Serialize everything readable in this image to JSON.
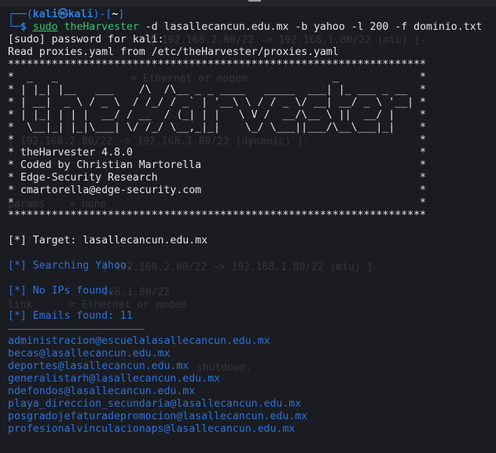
{
  "prompt": {
    "user": "kali",
    "host": "kali",
    "directory": "~",
    "at_symbol": "㉿"
  },
  "command": {
    "sudo": "sudo",
    "program": "theHarvester",
    "args": "-d lasallecancun.edu.mx -b yahoo -l 200 -f dominio.txt"
  },
  "output": {
    "sudo_prompt": "[sudo] password for kali:",
    "proxies_line": "Read proxies.yaml from /etc/theHarvester/proxies.yaml",
    "star_border": "*******************************************************************",
    "banner_lines": [
      "*  _   _                                            _             *",
      "* | |_| |__   ___    /\\  /\\__ _ _ ____   _____  ___| |_ ___ _ __  *",
      "* | __|  _ \\ / _ \\  / /_/ / _` | '__\\ \\ / / _ \\/ __| __/ _ \\ '__| *",
      "* | |_| | | |  __/ / __  / (_| | |   \\ V /  __/\\__ \\ ||  __/ |    *",
      "*  \\__|_| |_|\\___| \\/ /_/ \\__,_|_|    \\_/ \\___||___/\\__\\___|_|    *",
      "*                                                                 *"
    ],
    "info_lines": [
      "* theHarvester 4.8.0                                              *",
      "* Coded by Christian Martorella                                   *",
      "* Edge-Security Research                                          *",
      "* cmartorella@edge-security.com                                   *",
      "*                                                                 *"
    ],
    "target": "[*] Target: lasallecancun.edu.mx",
    "searching": "[*] Searching Yahoo.",
    "no_ips": "[*] No IPs found.",
    "emails_found": "[*] Emails found: 11",
    "emails": [
      "administracion@escuelalasallecancun.edu.mx",
      "becas@lasallecancun.edu.mx",
      "deportes@lasallecancun.edu.mx",
      "generalistarh@lasallecancun.edu.mx",
      "ndefondos@lasallecancun.edu.mx",
      "playa_direccion_secundaria@lasallecancun.edu.mx",
      "posgradojefaturadepromocion@lasallecancun.edu.mx",
      "profesionalvinculacionaps@lasallecancun.edu.mx"
    ]
  },
  "ghost_text": [
    "[ 192.168.2.80/22 ~> 192.168.1.80/22 (mtu) ]-",
    "= Ethernet or modem",
    "[ 192.168.2.80/22 ~> 192.168.1.80/22 (dynamic) ]-",
    "params    = none",
    "[ 192.168.2.80/22 ~> 192.168.1.80/22 (mtu) ]-",
    "168.1.80/22",
    "link      = Ethernet or modem",
    "shutdown."
  ],
  "colors": {
    "background": "#1a1c22",
    "prompt_blue": "#2f7fe0",
    "command_green": "#37c56b",
    "info_blue": "#2e72d8",
    "text": "#e6e6e6"
  }
}
